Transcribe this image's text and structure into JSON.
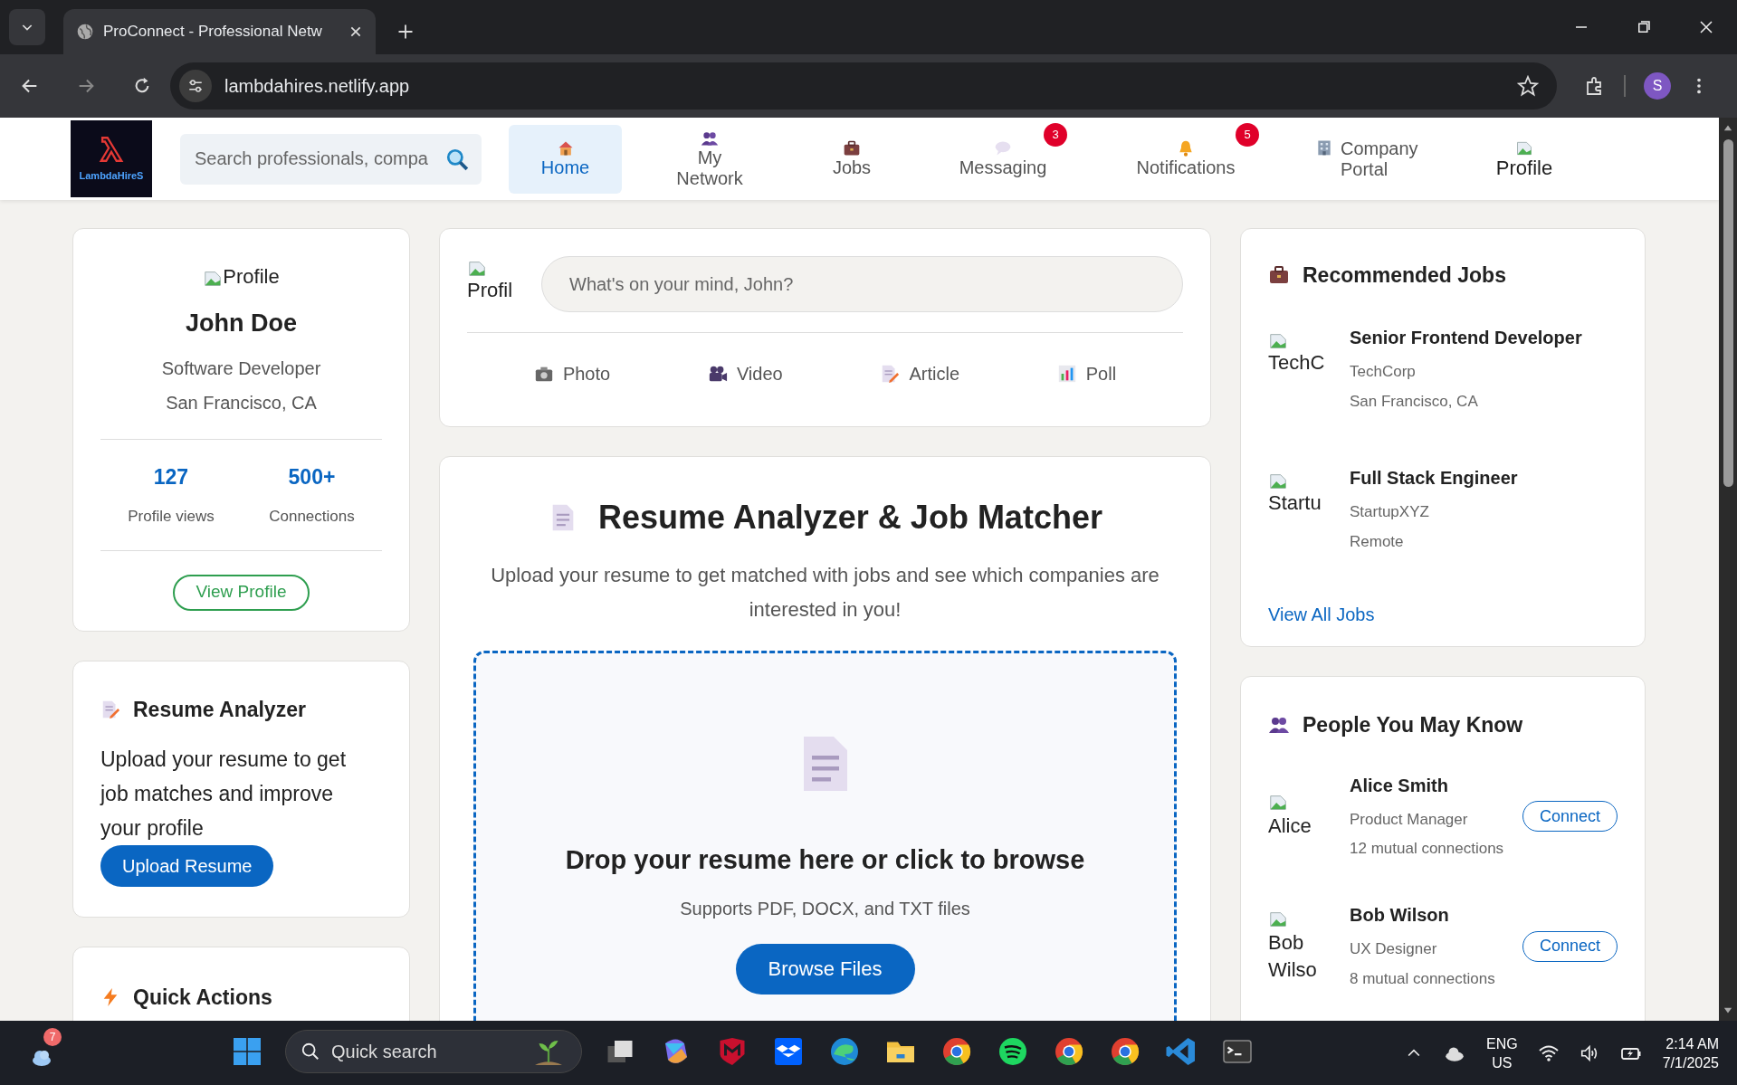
{
  "browser": {
    "tab_title": "ProConnect - Professional Netw",
    "url": "lambdahires.netlify.app",
    "profile_initial": "S"
  },
  "nav": {
    "logo": "LambdaHireS",
    "search_placeholder": "Search professionals, compa",
    "items": [
      {
        "kind": "home",
        "label": "Home",
        "selected": true
      },
      {
        "kind": "people",
        "label": "My Network",
        "selected": false
      },
      {
        "kind": "briefcase",
        "label": "Jobs",
        "selected": false
      },
      {
        "kind": "chat",
        "label": "Messaging",
        "selected": false,
        "badge": "3"
      },
      {
        "kind": "bell",
        "label": "Notifications",
        "selected": false,
        "badge": "5"
      },
      {
        "kind": "building",
        "label": "Company Portal",
        "selected": false
      },
      {
        "kind": "image",
        "label": "Profile",
        "selected": false
      }
    ]
  },
  "profile_card": {
    "image_alt": "Profile",
    "name": "John Doe",
    "title": "Software Developer",
    "location": "San Francisco, CA",
    "stats": [
      {
        "value": "127",
        "label": "Profile views"
      },
      {
        "value": "500+",
        "label": "Connections"
      }
    ],
    "button": "View Profile"
  },
  "resume_card": {
    "title": "Resume Analyzer",
    "text": "Upload your resume to get job matches and improve your profile",
    "button": "Upload Resume"
  },
  "quick_actions": {
    "title": "Quick Actions"
  },
  "composer": {
    "image_alt": "Profil",
    "placeholder": "What's on your mind, John?",
    "actions": [
      {
        "kind": "camera",
        "label": "Photo"
      },
      {
        "kind": "video",
        "label": "Video"
      },
      {
        "kind": "document",
        "label": "Article"
      },
      {
        "kind": "chart",
        "label": "Poll"
      }
    ]
  },
  "analyzer": {
    "title": "Resume Analyzer & Job Matcher",
    "subtitle": "Upload your resume to get matched with jobs and see which companies are interested in you!",
    "drop_title": "Drop your resume here or click to browse",
    "drop_hint": "Supports PDF, DOCX, and TXT files",
    "button": "Browse Files"
  },
  "jobs": {
    "title": "Recommended Jobs",
    "items": [
      {
        "image_alt": "TechC",
        "title": "Senior Frontend Developer",
        "company": "TechCorp",
        "location": "San Francisco, CA"
      },
      {
        "image_alt": "Startu",
        "title": "Full Stack Engineer",
        "company": "StartupXYZ",
        "location": "Remote"
      }
    ],
    "link": "View All Jobs"
  },
  "people": {
    "title": "People You May Know",
    "items": [
      {
        "image_alt": "Alice",
        "name": "Alice Smith",
        "role": "Product Manager",
        "mutual": "12 mutual connections",
        "button": "Connect"
      },
      {
        "image_alt": "Bob Wilso",
        "name": "Bob Wilson",
        "role": "UX Designer",
        "mutual": "8 mutual connections",
        "button": "Connect"
      }
    ]
  },
  "taskbar": {
    "weather_badge": "7",
    "search": "Quick search",
    "language": "ENG",
    "region": "US",
    "time": "2:14 AM",
    "date": "7/1/2025"
  }
}
